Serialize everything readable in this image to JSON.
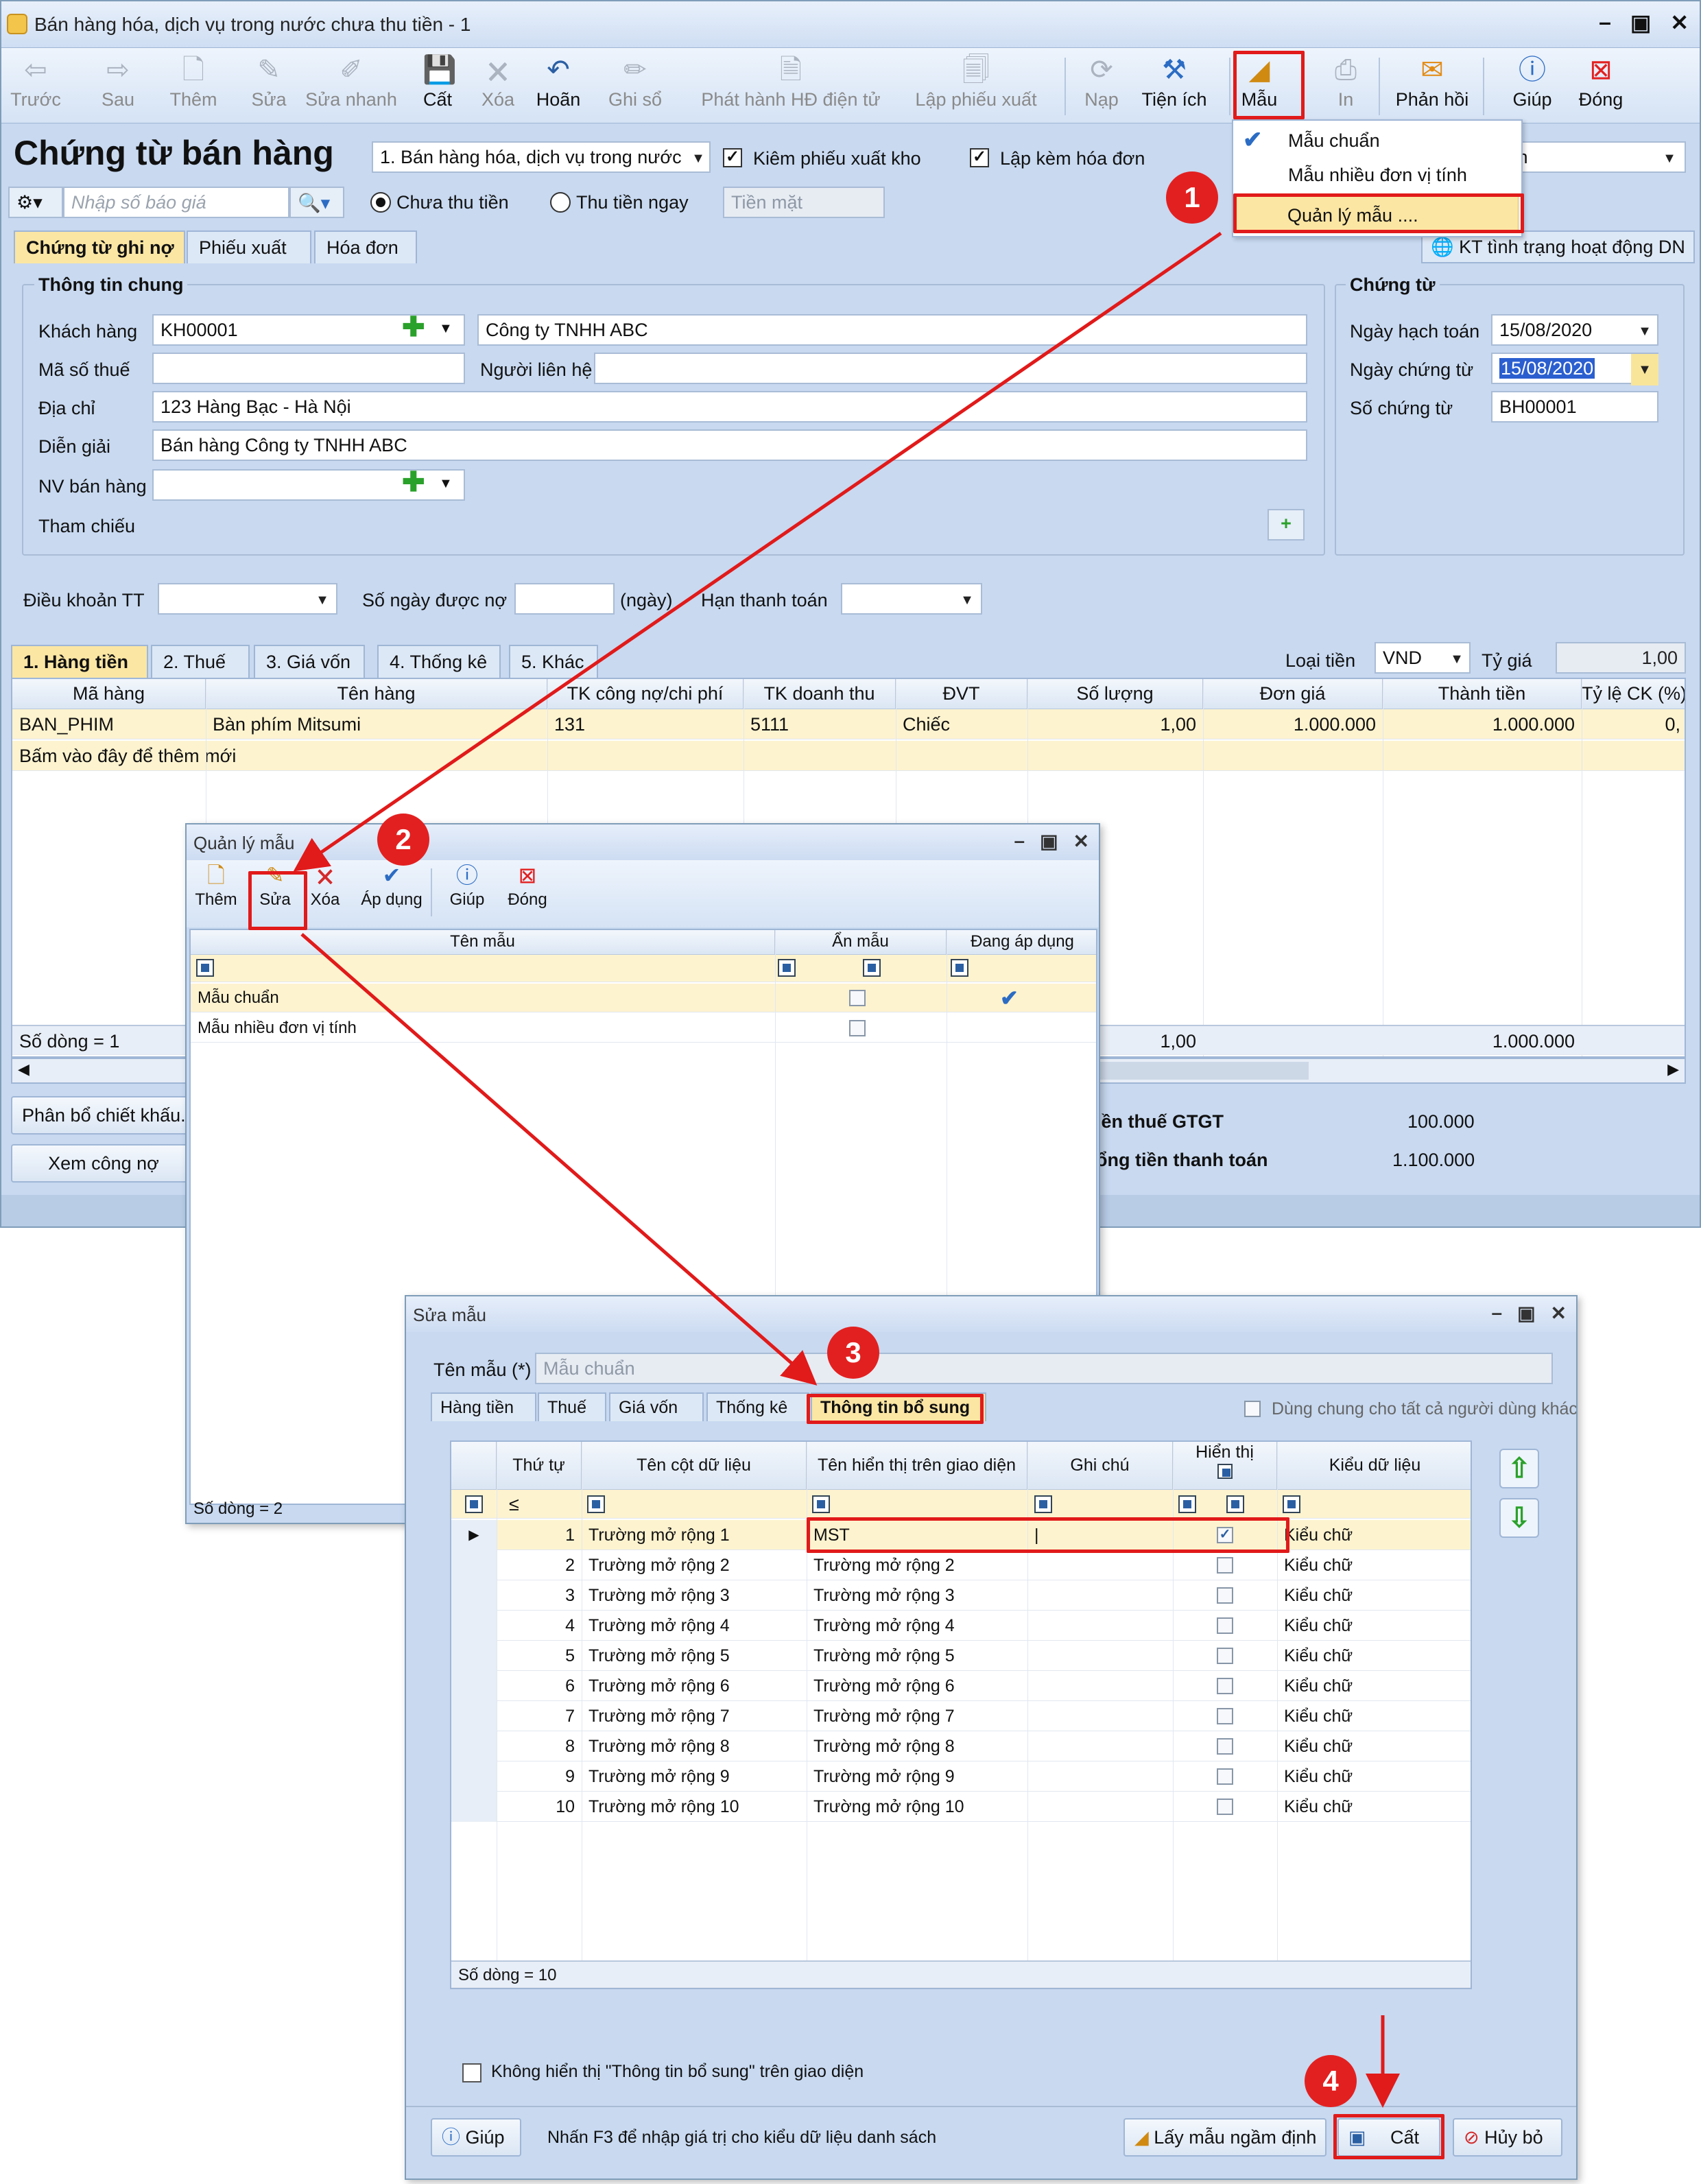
{
  "main": {
    "window_title": "Bán hàng hóa, dịch vụ trong nước chưa thu tiền - 1",
    "toolbar": [
      {
        "label": "Trước",
        "icon": "arrow-left-icon",
        "enabled": false
      },
      {
        "label": "Sau",
        "icon": "arrow-right-icon",
        "enabled": false
      },
      {
        "label": "Thêm",
        "icon": "new-doc-icon",
        "enabled": false
      },
      {
        "label": "Sửa",
        "icon": "edit-doc-icon",
        "enabled": false
      },
      {
        "label": "Sửa nhanh",
        "icon": "quick-edit-icon",
        "enabled": false
      },
      {
        "label": "Cất",
        "icon": "save-icon",
        "enabled": true
      },
      {
        "label": "Xóa",
        "icon": "delete-doc-icon",
        "enabled": false
      },
      {
        "label": "Hoãn",
        "icon": "undo-icon",
        "enabled": true
      },
      {
        "label": "Ghi sổ",
        "icon": "pen-icon",
        "enabled": false
      },
      {
        "label": "Phát hành HĐ điện tử",
        "icon": "einvoice-icon",
        "enabled": false
      },
      {
        "label": "Lập phiếu xuất",
        "icon": "export-slip-icon",
        "enabled": false
      },
      {
        "label": "Nạp",
        "icon": "reload-icon",
        "enabled": false
      },
      {
        "label": "Tiện ích",
        "icon": "tools-icon",
        "enabled": true
      },
      {
        "label": "Mẫu",
        "icon": "template-icon",
        "enabled": true
      },
      {
        "label": "In",
        "icon": "print-icon",
        "enabled": false
      },
      {
        "label": "Phản hồi",
        "icon": "mail-icon",
        "enabled": true
      },
      {
        "label": "Giúp",
        "icon": "help-icon",
        "enabled": true
      },
      {
        "label": "Đóng",
        "icon": "close-icon",
        "enabled": true
      }
    ],
    "template_menu": {
      "items": [
        "Mẫu chuẩn",
        "Mẫu nhiều đơn vị tính",
        "Quản lý mẫu ...."
      ]
    },
    "heading": "Chứng từ bán hàng",
    "sale_type": "1. Bán hàng hóa, dịch vụ trong nước",
    "check_export": "Kiêm phiếu xuất kho",
    "check_invoice": "Lập kèm hóa đơn",
    "right_combo_partial": "ính",
    "quote_placeholder": "Nhập số báo giá",
    "radio_unpaid": "Chưa thu tiền",
    "radio_paid": "Thu tiền ngay",
    "payment_method": "Tiền mặt",
    "tabs": [
      "Chứng từ ghi nợ",
      "Phiếu xuất",
      "Hóa đơn"
    ],
    "kt_link": "KT tình trạng hoạt động DN",
    "general": {
      "title": "Thông tin chung",
      "customer_label": "Khách hàng",
      "customer_code": "KH00001",
      "customer_name": "Công ty TNHH ABC",
      "tax_label": "Mã số thuế",
      "contact_label": "Người liên hệ",
      "address_label": "Địa chỉ",
      "address": "123 Hàng Bạc - Hà Nội",
      "desc_label": "Diễn giải",
      "desc": "Bán hàng Công ty TNHH ABC",
      "staff_label": "NV bán hàng",
      "ref_label": "Tham chiếu"
    },
    "voucher": {
      "title": "Chứng từ",
      "post_date_label": "Ngày hạch toán",
      "post_date": "15/08/2020",
      "doc_date_label": "Ngày chứng từ",
      "doc_date": "15/08/2020",
      "doc_no_label": "Số chứng từ",
      "doc_no": "BH00001"
    },
    "terms": {
      "term_label": "Điều khoản TT",
      "days_label": "Số ngày được nợ",
      "days_unit": "(ngày)",
      "due_label": "Hạn thanh toán"
    },
    "grid_tabs": [
      "1. Hàng tiền",
      "2. Thuế",
      "3. Giá vốn",
      "4. Thống kê",
      "5. Khác"
    ],
    "currency_label": "Loại tiền",
    "currency": "VND",
    "rate_label": "Tỷ giá",
    "rate": "1,00",
    "grid": {
      "headers": [
        "Mã hàng",
        "Tên hàng",
        "TK công nợ/chi phí",
        "TK doanh thu",
        "ĐVT",
        "Số lượng",
        "Đơn giá",
        "Thành tiền",
        "Tỷ lệ CK (%)"
      ],
      "rows": [
        [
          "BAN_PHIM",
          "Bàn phím Mitsumi",
          "131",
          "5111",
          "Chiếc",
          "1,00",
          "1.000.000",
          "1.000.000",
          "0,"
        ]
      ],
      "add_row": "Bấm vào đây để thêm mới",
      "footer_count": "Số dòng = 1",
      "footer_qty": "1,00",
      "footer_total": "1.000.000"
    },
    "btn_allocate": "Phân bổ chiết khấu...",
    "btn_debt": "Xem công nợ",
    "vat_label": "iền thuế GTGT",
    "vat": "100.000",
    "total_label": "ổng tiền thanh toán",
    "total": "1.100.000"
  },
  "manage": {
    "title": "Quản lý mẫu",
    "toolbar": [
      {
        "label": "Thêm",
        "icon": "new-doc-icon"
      },
      {
        "label": "Sửa",
        "icon": "edit-doc-icon"
      },
      {
        "label": "Xóa",
        "icon": "delete-doc-icon"
      },
      {
        "label": "Áp dụng",
        "icon": "check-icon"
      },
      {
        "label": "Giúp",
        "icon": "help-icon"
      },
      {
        "label": "Đóng",
        "icon": "close-icon"
      }
    ],
    "headers": [
      "Tên mẫu",
      "Ẩn mẫu",
      "Đang áp dụng"
    ],
    "rows": [
      {
        "name": "Mẫu chuẩn",
        "hidden": false,
        "active": true
      },
      {
        "name": "Mẫu nhiều đơn vị tính",
        "hidden": false,
        "active": false
      }
    ],
    "footer": "Số dòng = 2"
  },
  "edit": {
    "title": "Sửa mẫu",
    "name_label": "Tên mẫu (*)",
    "name_value": "Mẫu chuẩn",
    "tabs": [
      "Hàng tiền",
      "Thuế",
      "Giá vốn",
      "Thống kê",
      "Thông tin bổ sung"
    ],
    "share_label": "Dùng chung cho tất cả người dùng khác",
    "headers": [
      "Thứ tự",
      "Tên cột dữ liệu",
      "Tên hiển thị trên giao diện",
      "Ghi chú",
      "Hiển thị",
      "Kiểu dữ liệu"
    ],
    "filter_le": "≤",
    "rows": [
      {
        "no": "1",
        "col": "Trường mở rộng 1",
        "display": "MST",
        "show": true,
        "type": "Kiểu chữ"
      },
      {
        "no": "2",
        "col": "Trường mở rộng 2",
        "display": "Trường mở rộng 2",
        "show": false,
        "type": "Kiểu chữ"
      },
      {
        "no": "3",
        "col": "Trường mở rộng 3",
        "display": "Trường mở rộng 3",
        "show": false,
        "type": "Kiểu chữ"
      },
      {
        "no": "4",
        "col": "Trường mở rộng 4",
        "display": "Trường mở rộng 4",
        "show": false,
        "type": "Kiểu chữ"
      },
      {
        "no": "5",
        "col": "Trường mở rộng 5",
        "display": "Trường mở rộng 5",
        "show": false,
        "type": "Kiểu chữ"
      },
      {
        "no": "6",
        "col": "Trường mở rộng 6",
        "display": "Trường mở rộng 6",
        "show": false,
        "type": "Kiểu chữ"
      },
      {
        "no": "7",
        "col": "Trường mở rộng 7",
        "display": "Trường mở rộng 7",
        "show": false,
        "type": "Kiểu chữ"
      },
      {
        "no": "8",
        "col": "Trường mở rộng 8",
        "display": "Trường mở rộng 8",
        "show": false,
        "type": "Kiểu chữ"
      },
      {
        "no": "9",
        "col": "Trường mở rộng 9",
        "display": "Trường mở rộng 9",
        "show": false,
        "type": "Kiểu chữ"
      },
      {
        "no": "10",
        "col": "Trường mở rộng 10",
        "display": "Trường mở rộng 10",
        "show": false,
        "type": "Kiểu chữ"
      }
    ],
    "footer": "Số dòng = 10",
    "hide_label": "Không hiển thị \"Thông tin bổ sung\" trên giao diện",
    "help_btn": "Giúp",
    "hint": "Nhấn F3 để nhập giá trị cho kiểu dữ liệu danh sách",
    "default_btn": "Lấy mẫu ngầm định",
    "save_btn": "Cất",
    "cancel_btn": "Hủy bỏ"
  },
  "steps": [
    "1",
    "2",
    "3",
    "4"
  ],
  "colors": {
    "highlight": "#e11a1a",
    "selected_row": "#fdf3cf",
    "active_tab": "#fbe6a3"
  }
}
